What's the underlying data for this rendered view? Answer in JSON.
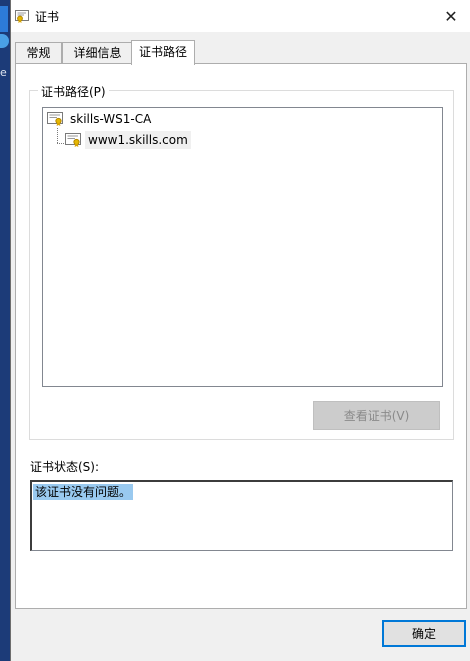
{
  "window": {
    "title": "证书",
    "close_glyph": "✕"
  },
  "desktop": {
    "edge_letter": "e"
  },
  "tabs": [
    {
      "label": "常规",
      "active": false
    },
    {
      "label": "详细信息",
      "active": false
    },
    {
      "label": "证书路径",
      "active": true
    }
  ],
  "path_group": {
    "label": "证书路径(P)",
    "tree": [
      {
        "label": "skills-WS1-CA",
        "icon": "certificate-icon",
        "level": 0
      },
      {
        "label": "www1.skills.com",
        "icon": "certificate-icon",
        "level": 1,
        "selected": true
      }
    ],
    "view_button": "查看证书(V)"
  },
  "status": {
    "label": "证书状态(S):",
    "text": "该证书没有问题。"
  },
  "ok_button": "确定",
  "colors": {
    "accent": "#0078d7",
    "selection": "#99c9ef"
  }
}
